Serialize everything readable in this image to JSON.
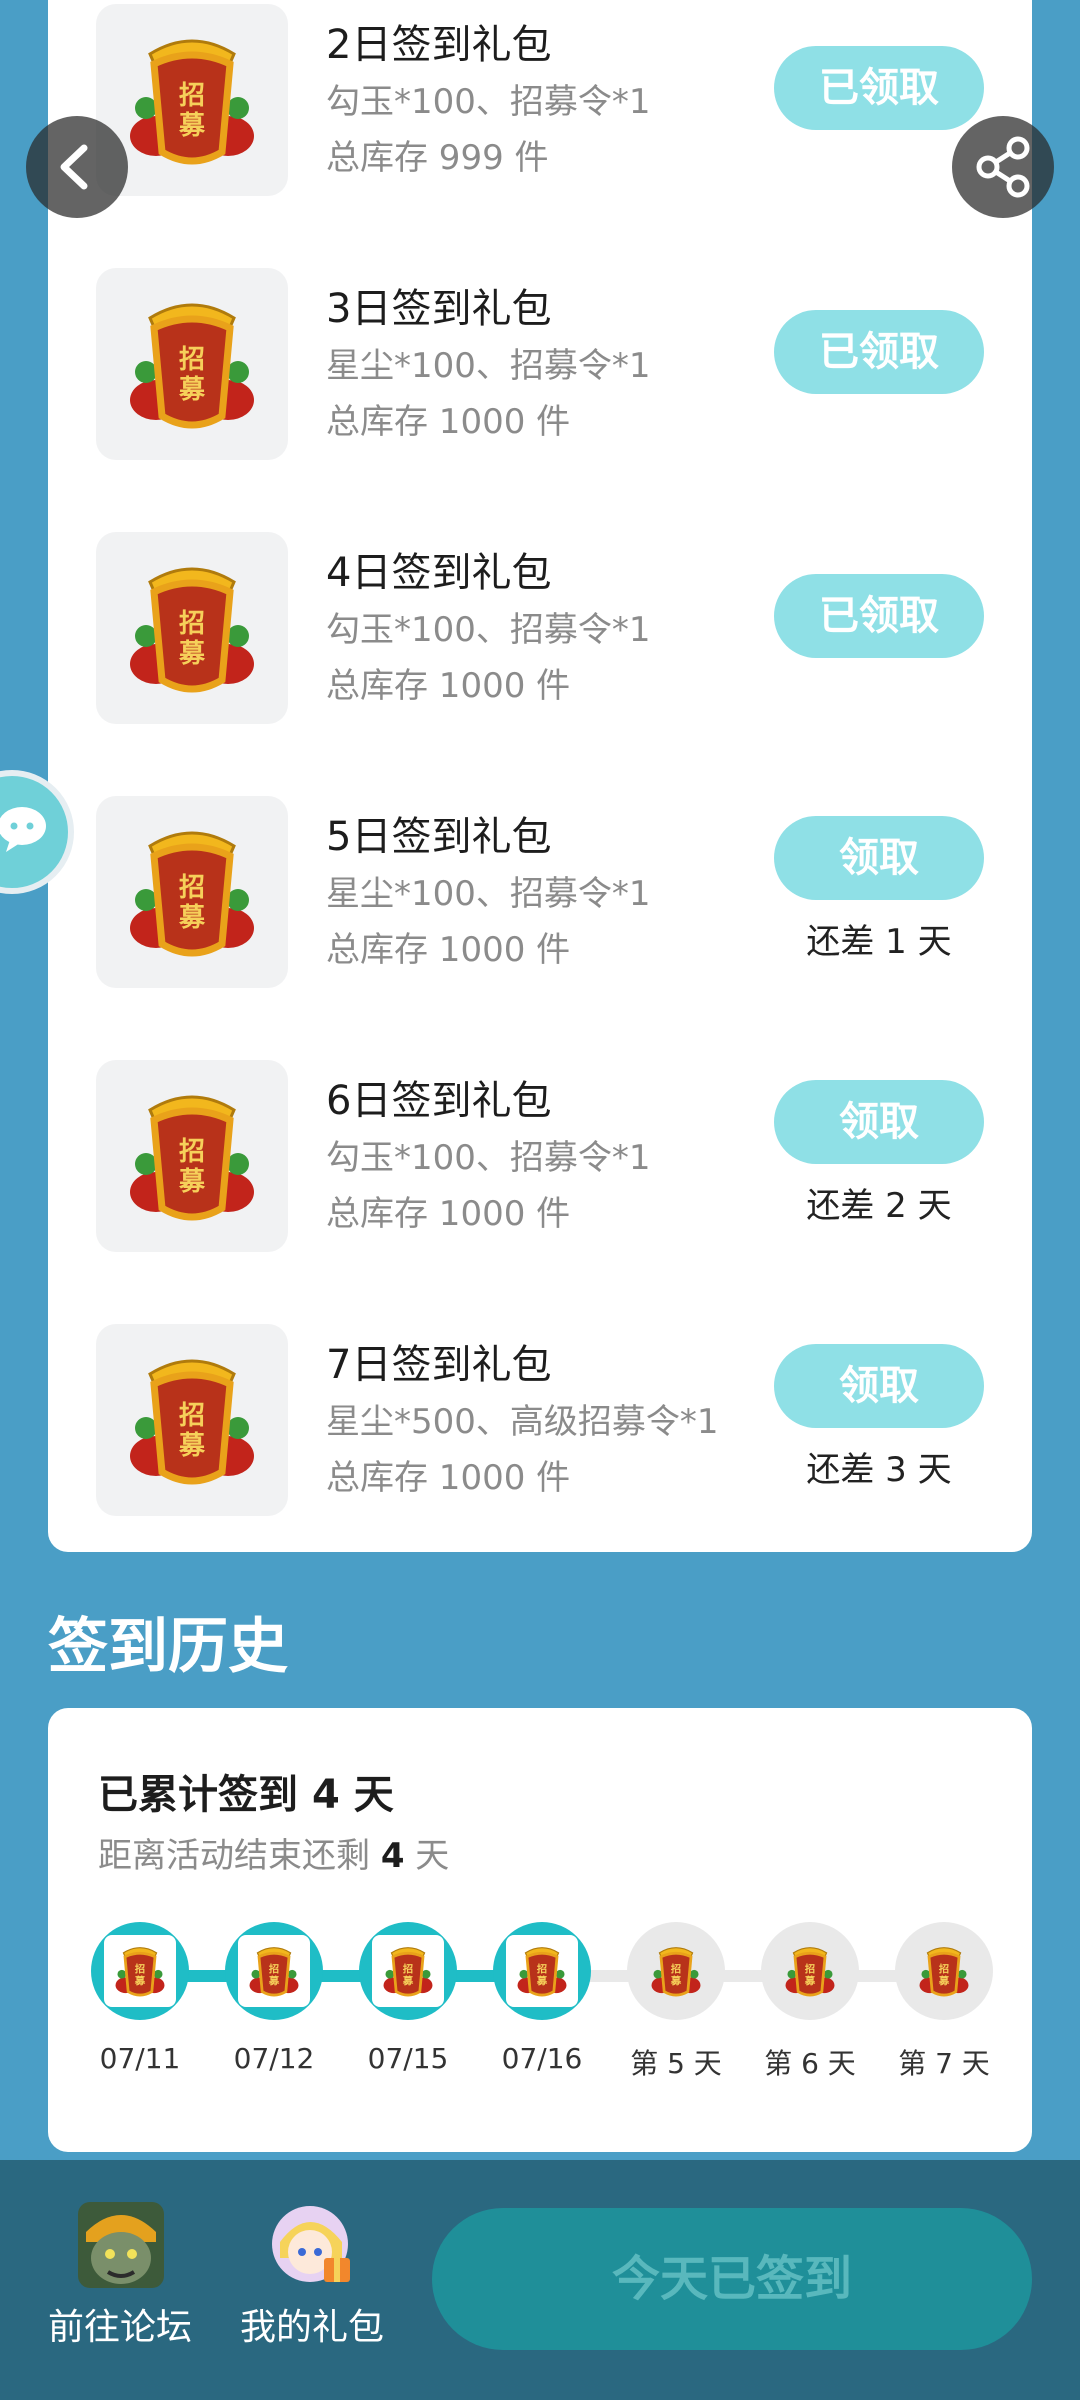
{
  "gift_list": {
    "items": [
      {
        "title": "2日签到礼包",
        "content": "勾玉*100、招募令*1",
        "stock": "总库存 999 件",
        "button": "已领取",
        "days_left": ""
      },
      {
        "title": "3日签到礼包",
        "content": "星尘*100、招募令*1",
        "stock": "总库存 1000 件",
        "button": "已领取",
        "days_left": ""
      },
      {
        "title": "4日签到礼包",
        "content": "勾玉*100、招募令*1",
        "stock": "总库存 1000 件",
        "button": "已领取",
        "days_left": ""
      },
      {
        "title": "5日签到礼包",
        "content": "星尘*100、招募令*1",
        "stock": "总库存 1000 件",
        "button": "领取",
        "days_left": "还差 1 天"
      },
      {
        "title": "6日签到礼包",
        "content": "勾玉*100、招募令*1",
        "stock": "总库存 1000 件",
        "button": "领取",
        "days_left": "还差 2 天"
      },
      {
        "title": "7日签到礼包",
        "content": "星尘*500、高级招募令*1",
        "stock": "总库存 1000 件",
        "button": "领取",
        "days_left": "还差 3 天"
      }
    ],
    "gift_icon_text": "招募"
  },
  "history": {
    "heading": "签到历史",
    "total_prefix": "已累计签到 ",
    "total_days": "4",
    "total_suffix": " 天",
    "remaining_prefix": "距离活动结束还剩 ",
    "remaining_days": "4",
    "remaining_suffix": " 天",
    "days": [
      {
        "label": "07/11",
        "done": true
      },
      {
        "label": "07/12",
        "done": true
      },
      {
        "label": "07/15",
        "done": true
      },
      {
        "label": "07/16",
        "done": true
      },
      {
        "label": "第 5 天",
        "done": false
      },
      {
        "label": "第 6 天",
        "done": false
      },
      {
        "label": "第 7 天",
        "done": false
      }
    ]
  },
  "bottom_bar": {
    "forum_label": "前往论坛",
    "gifts_label": "我的礼包",
    "checkin_label": "今天已签到"
  },
  "icons": {
    "back": "chevron-left-icon",
    "share": "share-icon",
    "chat": "chat-icon"
  },
  "colors": {
    "background": "#4a9ec6",
    "button": "#8fe0e6",
    "timeline_done": "#1fbdc6",
    "timeline_todo": "#e9e9e9",
    "bottom_bar": "#2a6880",
    "checkin_button": "#1f8f99"
  }
}
